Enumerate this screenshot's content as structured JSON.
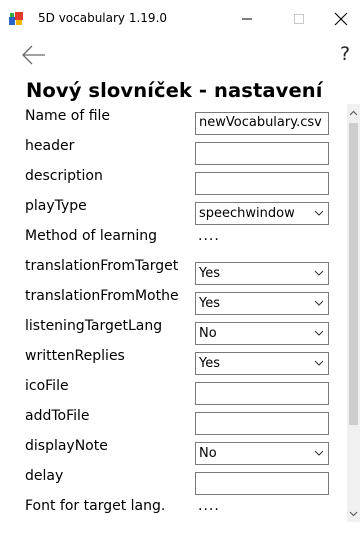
{
  "window": {
    "title": "5D vocabulary 1.19.0",
    "icon": "app-icon",
    "controls": [
      "minimize-icon",
      "maximize-icon",
      "close-icon"
    ]
  },
  "toolbar": {
    "back_icon": "back-arrow-icon",
    "help_label": "?"
  },
  "page_title": "Nový slovníček - nastavení",
  "form": {
    "name_of_file": {
      "label": "Name of file",
      "value": "newVocabulary.csv"
    },
    "header": {
      "label": "header",
      "value": ""
    },
    "description": {
      "label": "description",
      "value": ""
    },
    "play_type": {
      "label": "playType",
      "value": "speechwindow"
    },
    "method_of_learning": {
      "label": "Method of learning",
      "value": "...."
    },
    "translation_from_target": {
      "label": "translationFromTarget",
      "value": "Yes"
    },
    "translation_from_mother": {
      "label": "translationFromMothe",
      "value": "Yes"
    },
    "listening_target_lang": {
      "label": "listeningTargetLang",
      "value": "No"
    },
    "written_replies": {
      "label": "writtenReplies",
      "value": "Yes"
    },
    "ico_file": {
      "label": "icoFile",
      "value": ""
    },
    "add_to_file": {
      "label": "addToFile",
      "value": ""
    },
    "display_note": {
      "label": "displayNote",
      "value": "No"
    },
    "delay": {
      "label": "delay",
      "value": ""
    },
    "font_for_target_lang": {
      "label": "Font for target lang.",
      "value": "...."
    }
  },
  "colors": {
    "border": "#7a7a7a",
    "scrollbar_track": "#f0f0f0",
    "scrollbar_thumb": "#cdcdcd"
  }
}
